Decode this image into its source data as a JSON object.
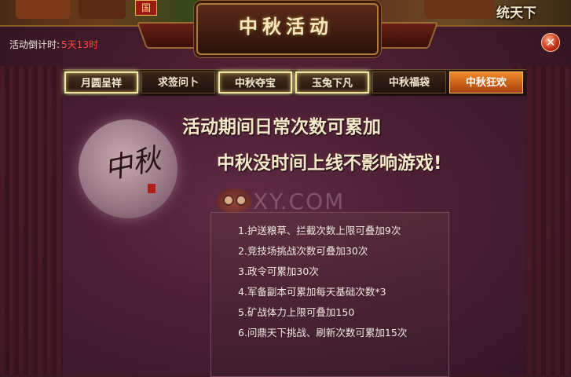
{
  "world": {
    "badge": "国",
    "right_text": "统天下"
  },
  "header": {
    "title": "中秋活动",
    "countdown_label": "活动倒计时:",
    "countdown_value": "5天13时",
    "close_label": "✕"
  },
  "tabs": [
    {
      "label": "月圆呈祥",
      "state": "highlighted"
    },
    {
      "label": "求签问卜",
      "state": "normal"
    },
    {
      "label": "中秋夺宝",
      "state": "highlighted"
    },
    {
      "label": "玉兔下凡",
      "state": "highlighted"
    },
    {
      "label": "中秋福袋",
      "state": "normal"
    },
    {
      "label": "中秋狂欢",
      "state": "active"
    }
  ],
  "content": {
    "moon_text": "中秋",
    "headline_1": "活动期间日常次数可累加",
    "headline_2": "中秋没时间上线不影响游戏!",
    "watermark": "XY.COM",
    "rules": [
      "1.护送粮草、拦截次数上限可叠加9次",
      "2.竞技场挑战次数可叠加30次",
      "3.政令可累加30次",
      "4.军备副本可累加每天基础次数*3",
      "5.矿战体力上限可叠加150",
      "6.问鼎天下挑战、刷新次数可累加15次"
    ]
  },
  "colors": {
    "accent": "#f08a2a",
    "countdown": "#ff4a3a",
    "panel_bg": "#3e1a2a"
  }
}
